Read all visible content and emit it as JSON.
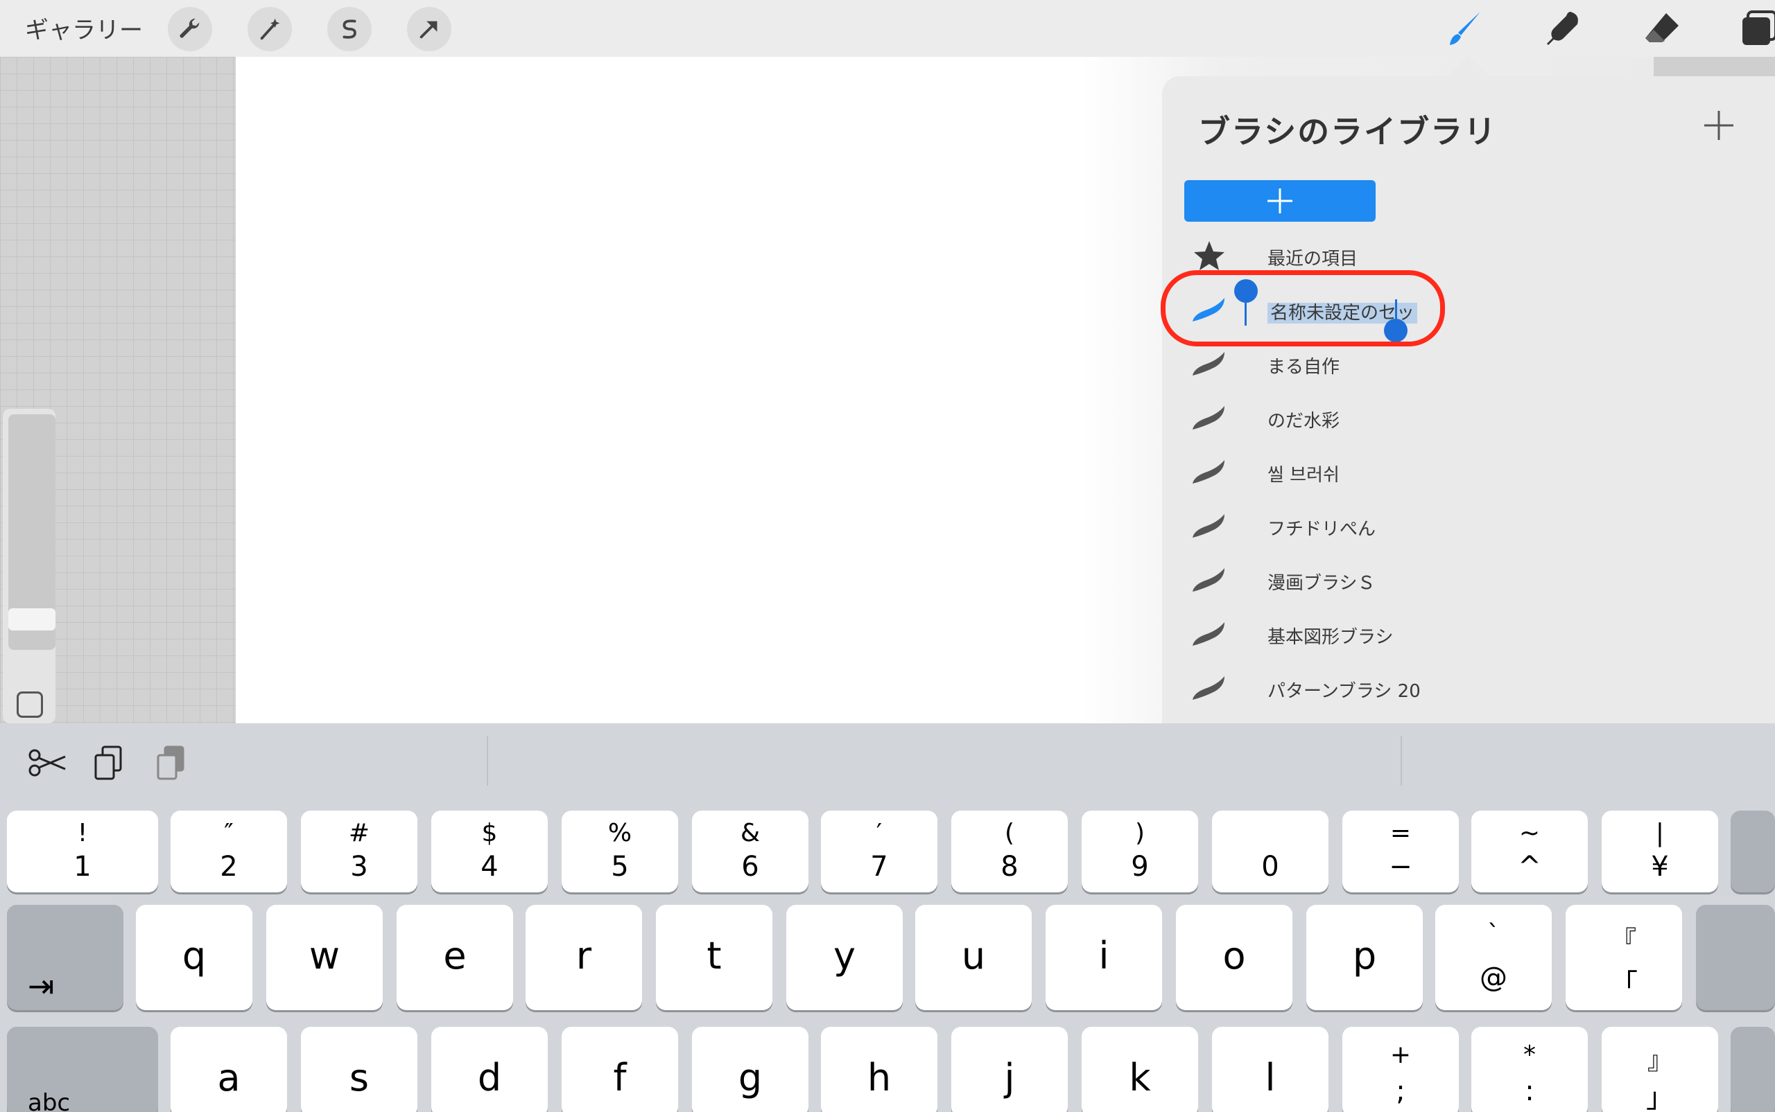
{
  "topbar": {
    "gallery_label": "ギャラリー",
    "tools": [
      "wrench-icon",
      "magic-wand-icon",
      "selection-s-icon",
      "arrow-transform-icon"
    ],
    "right_tools": [
      "brush-icon",
      "smudge-icon",
      "eraser-icon",
      "layers-icon"
    ],
    "active_tool": "brush-icon",
    "accent_color": "#1e8af2"
  },
  "panel": {
    "title": "ブラシのライブラリ",
    "add_icon": "plus-icon",
    "new_set_icon": "plus-icon",
    "items": [
      {
        "label": "最近の項目",
        "icon": "star-icon"
      },
      {
        "label": "名称未設定のセッ",
        "icon": "brush-stroke-icon",
        "selected": true,
        "editing": true
      },
      {
        "label": "まる自作",
        "icon": "brush-stroke-icon"
      },
      {
        "label": "のだ水彩",
        "icon": "brush-stroke-icon"
      },
      {
        "label": "씰 브러쉬",
        "icon": "brush-stroke-icon"
      },
      {
        "label": "フチドリぺん",
        "icon": "brush-stroke-icon"
      },
      {
        "label": "漫画ブラシＳ",
        "icon": "brush-stroke-icon"
      },
      {
        "label": "基本図形ブラシ",
        "icon": "brush-stroke-icon"
      },
      {
        "label": "パターンブラシ 20",
        "icon": "brush-stroke-icon"
      }
    ],
    "highlight_color": "#ff2a1a"
  },
  "keyboard": {
    "tools": [
      "scissors-icon",
      "copy-icon",
      "paste-icon"
    ],
    "row1": [
      {
        "sym": "!",
        "num": "1"
      },
      {
        "sym": "″",
        "num": "2"
      },
      {
        "sym": "#",
        "num": "3"
      },
      {
        "sym": "$",
        "num": "4"
      },
      {
        "sym": "%",
        "num": "5"
      },
      {
        "sym": "&",
        "num": "6"
      },
      {
        "sym": "′",
        "num": "7"
      },
      {
        "sym": "(",
        "num": "8"
      },
      {
        "sym": ")",
        "num": "9"
      },
      {
        "sym": "",
        "num": "0"
      },
      {
        "sym": "=",
        "num": "−"
      },
      {
        "sym": "~",
        "num": "^"
      },
      {
        "sym": "|",
        "num": "¥"
      }
    ],
    "row2_tab": "⇥",
    "row2": [
      "q",
      "w",
      "e",
      "r",
      "t",
      "y",
      "u",
      "i",
      "o",
      "p"
    ],
    "row2_extra": [
      {
        "sym": "`",
        "num": "@"
      },
      {
        "sym": "『",
        "num": "「"
      }
    ],
    "row3_mode": "abc",
    "row3": [
      "a",
      "s",
      "d",
      "f",
      "g",
      "h",
      "j",
      "k",
      "l"
    ],
    "row3_extra": [
      {
        "sym": "+",
        "num": ";"
      },
      {
        "sym": "*",
        "num": ":"
      },
      {
        "sym": "』",
        "num": "」"
      }
    ]
  }
}
